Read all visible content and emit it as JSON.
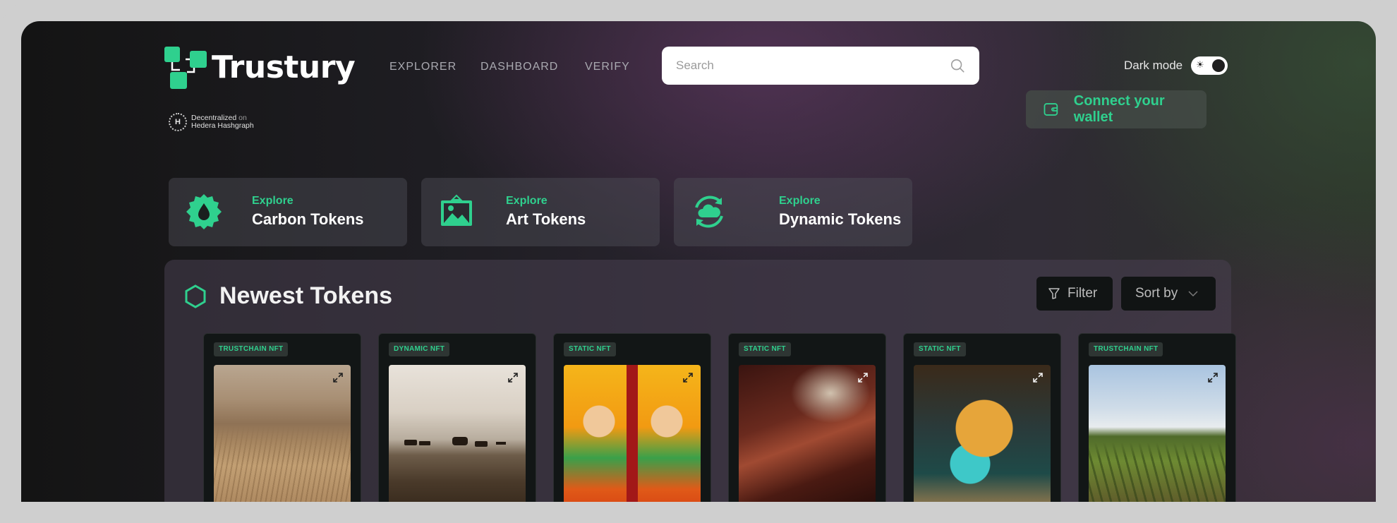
{
  "brand": {
    "name": "Trustury",
    "tagline_line1": "Decentralized",
    "tagline_on": "on",
    "tagline_line2": "Hedera Hashgraph",
    "hedera_mark": "H",
    "accent_color": "#2fd08e"
  },
  "nav": {
    "items": [
      {
        "label": "EXPLORER"
      },
      {
        "label": "DASHBOARD"
      },
      {
        "label": "VERIFY"
      }
    ]
  },
  "search": {
    "placeholder": "Search",
    "value": "",
    "icon": "search-icon"
  },
  "theme": {
    "dark_mode_label": "Dark mode",
    "dark_mode_on": true,
    "sun_glyph": "☀"
  },
  "wallet": {
    "label": "Connect your wallet",
    "icon": "wallet-icon"
  },
  "categories": [
    {
      "pre": "Explore",
      "title": "Carbon Tokens",
      "icon": "droplet-icon"
    },
    {
      "pre": "Explore",
      "title": "Art Tokens",
      "icon": "image-icon"
    },
    {
      "pre": "Explore",
      "title": "Dynamic Tokens",
      "icon": "cloud-sync-icon"
    }
  ],
  "newest": {
    "title": "Newest Tokens",
    "icon": "hexagon-icon",
    "filter_label": "Filter",
    "sort_label": "Sort by",
    "tokens": [
      {
        "badge": "TRUSTCHAIN NFT",
        "image": "wheat-field-harvester"
      },
      {
        "badge": "DYNAMIC NFT",
        "image": "cattle-grazing-dusk"
      },
      {
        "badge": "STATIC NFT",
        "image": "pixel-art-kings"
      },
      {
        "badge": "STATIC NFT",
        "image": "violin-closeup"
      },
      {
        "badge": "STATIC NFT",
        "image": "robot-head-helmet"
      },
      {
        "badge": "TRUSTCHAIN NFT",
        "image": "crop-field-rows"
      }
    ]
  }
}
